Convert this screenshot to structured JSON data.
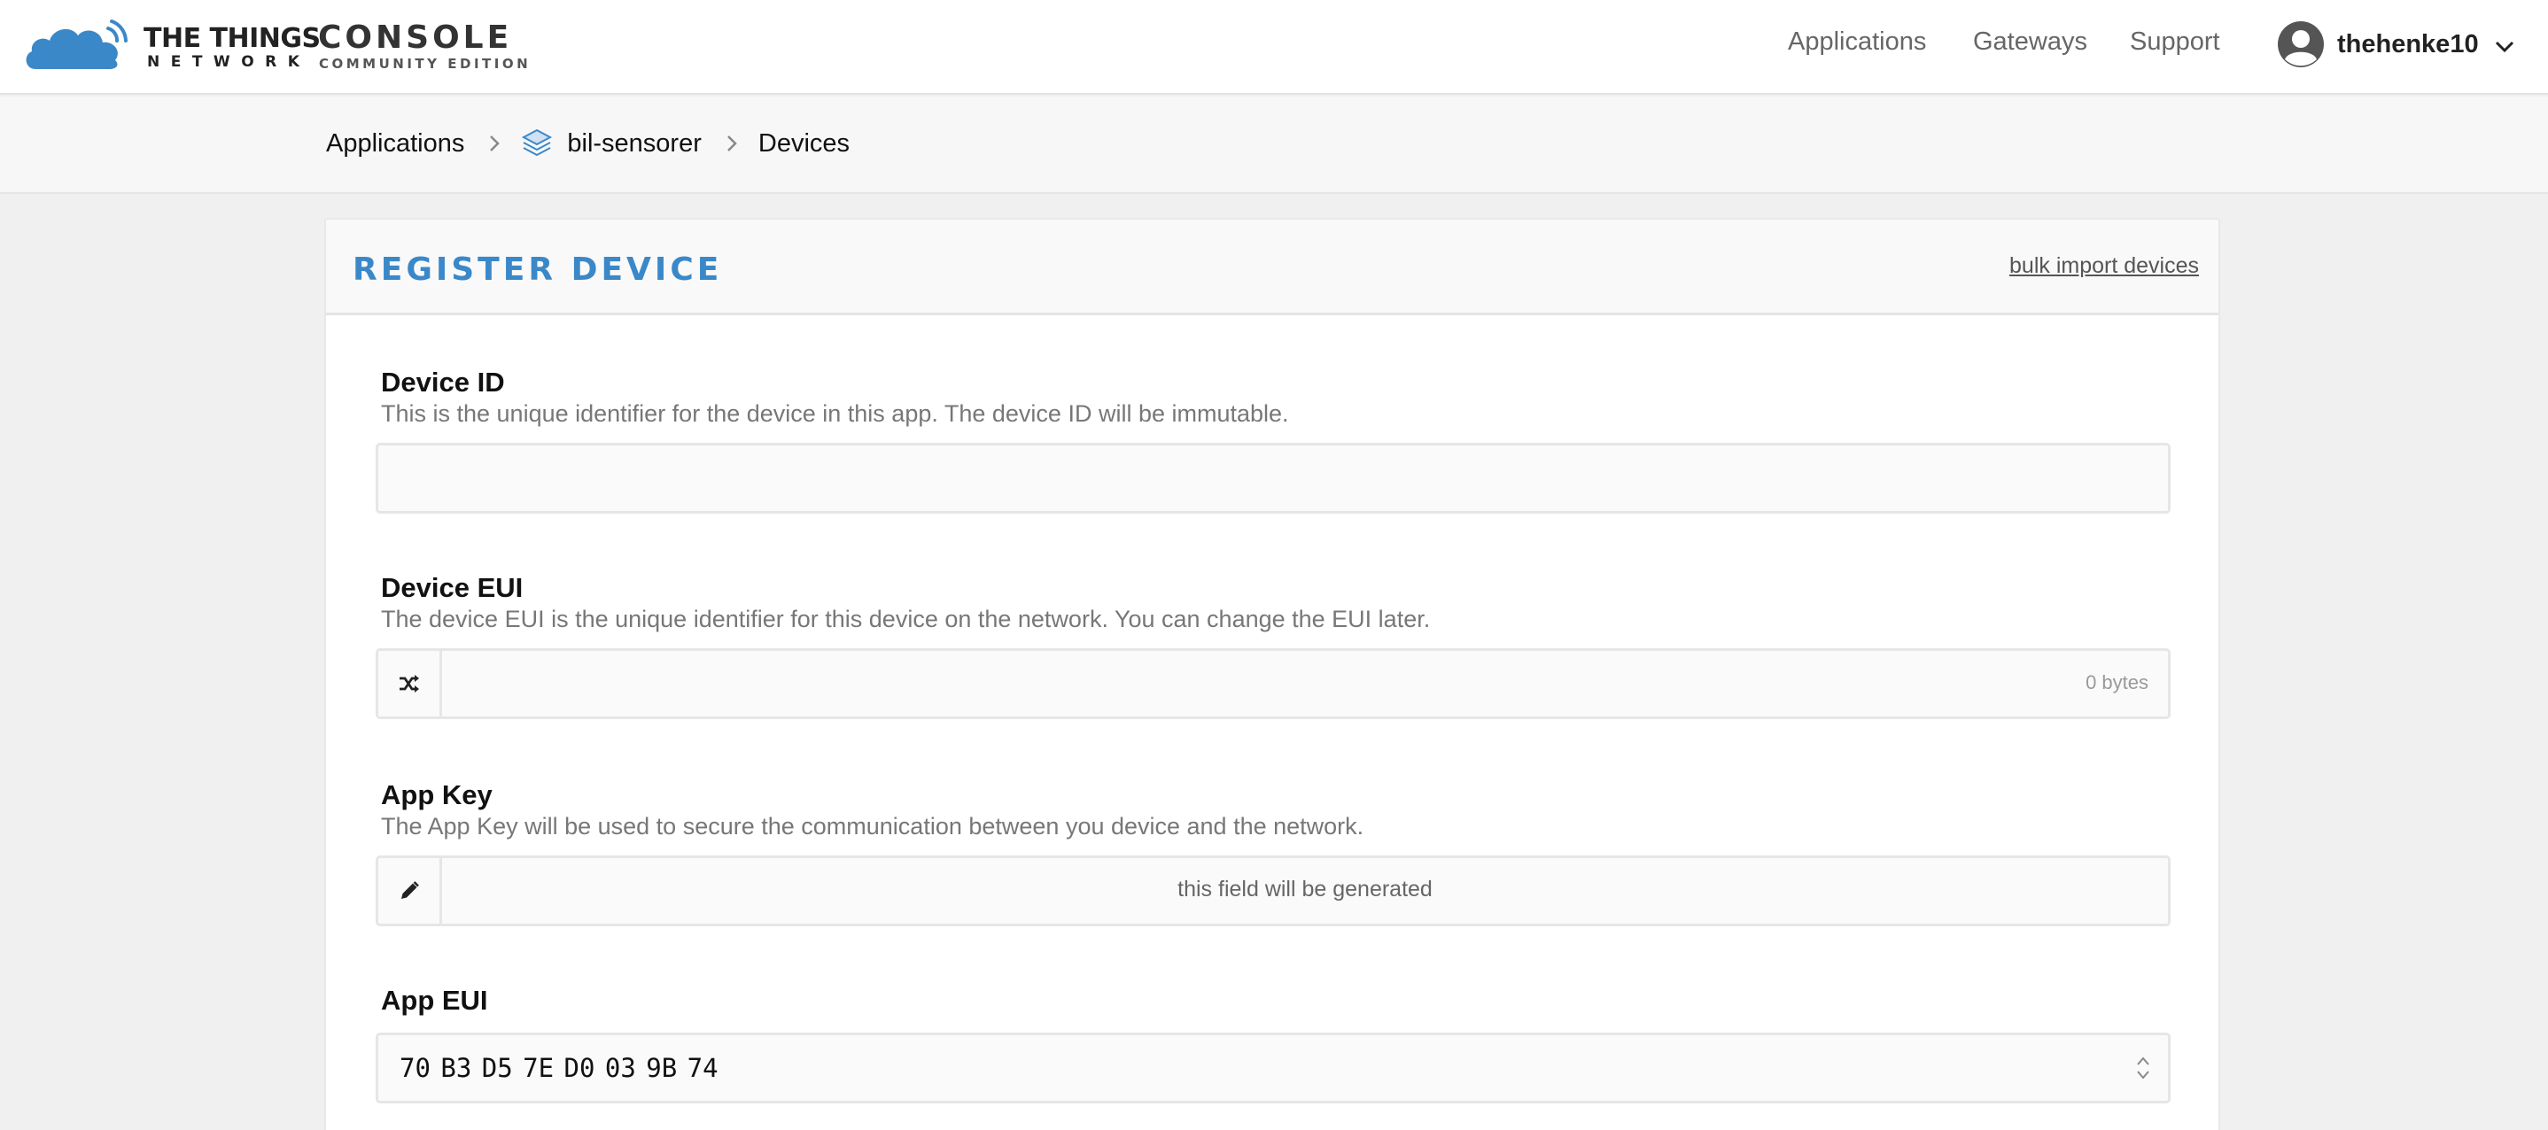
{
  "brand": {
    "name_line1": "THE THINGS",
    "name_line2": "NETWORK",
    "product": "CONSOLE",
    "edition": "COMMUNITY EDITION",
    "accent_color": "#3b88c9"
  },
  "nav": {
    "applications": "Applications",
    "gateways": "Gateways",
    "support": "Support",
    "username": "thehenke10"
  },
  "breadcrumb": {
    "applications": "Applications",
    "app_name": "bil-sensorer",
    "devices": "Devices"
  },
  "card": {
    "title": "REGISTER DEVICE",
    "bulk_import": "bulk import devices"
  },
  "fields": {
    "device_id": {
      "label": "Device ID",
      "description": "This is the unique identifier for the device in this app. The device ID will be immutable.",
      "value": ""
    },
    "device_eui": {
      "label": "Device EUI",
      "description": "The device EUI is the unique identifier for this device on the network. You can change the EUI later.",
      "value": "",
      "byte_count": "0 bytes",
      "addon_icon": "shuffle-icon"
    },
    "app_key": {
      "label": "App Key",
      "description": "The App Key will be used to secure the communication between you device and the network.",
      "placeholder": "this field will be generated",
      "addon_icon": "pencil-icon"
    },
    "app_eui": {
      "label": "App EUI",
      "value": "70 B3 D5 7E D0 03 9B 74"
    }
  }
}
